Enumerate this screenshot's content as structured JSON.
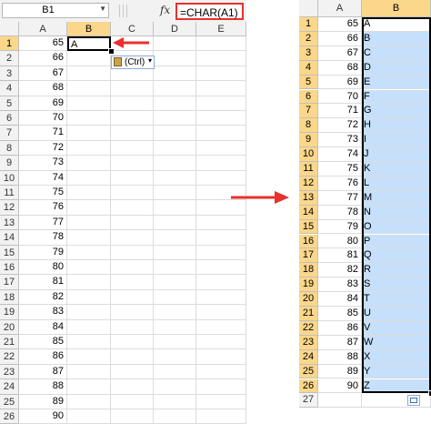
{
  "formula_bar": {
    "name_box": "B1",
    "fx_label": "fx",
    "formula": "=CHAR(A1)"
  },
  "left_sheet": {
    "columns": [
      "A",
      "B",
      "C",
      "D",
      "E"
    ],
    "rows": [
      {
        "row": "1",
        "a": "65",
        "b": "A"
      },
      {
        "row": "2",
        "a": "66",
        "b": ""
      },
      {
        "row": "3",
        "a": "67",
        "b": ""
      },
      {
        "row": "4",
        "a": "68",
        "b": ""
      },
      {
        "row": "5",
        "a": "69",
        "b": ""
      },
      {
        "row": "6",
        "a": "70",
        "b": ""
      },
      {
        "row": "7",
        "a": "71",
        "b": ""
      },
      {
        "row": "8",
        "a": "72",
        "b": ""
      },
      {
        "row": "9",
        "a": "73",
        "b": ""
      },
      {
        "row": "10",
        "a": "74",
        "b": ""
      },
      {
        "row": "11",
        "a": "75",
        "b": ""
      },
      {
        "row": "12",
        "a": "76",
        "b": ""
      },
      {
        "row": "13",
        "a": "77",
        "b": ""
      },
      {
        "row": "14",
        "a": "78",
        "b": ""
      },
      {
        "row": "15",
        "a": "79",
        "b": ""
      },
      {
        "row": "16",
        "a": "80",
        "b": ""
      },
      {
        "row": "17",
        "a": "81",
        "b": ""
      },
      {
        "row": "18",
        "a": "82",
        "b": ""
      },
      {
        "row": "19",
        "a": "83",
        "b": ""
      },
      {
        "row": "20",
        "a": "84",
        "b": ""
      },
      {
        "row": "21",
        "a": "85",
        "b": ""
      },
      {
        "row": "22",
        "a": "86",
        "b": ""
      },
      {
        "row": "23",
        "a": "87",
        "b": ""
      },
      {
        "row": "24",
        "a": "88",
        "b": ""
      },
      {
        "row": "25",
        "a": "89",
        "b": ""
      },
      {
        "row": "26",
        "a": "90",
        "b": ""
      }
    ],
    "paste_options_label": "(Ctrl)"
  },
  "right_sheet": {
    "columns": [
      "A",
      "B"
    ],
    "rows": [
      {
        "row": "1",
        "a": "65",
        "b": "A"
      },
      {
        "row": "2",
        "a": "66",
        "b": "B"
      },
      {
        "row": "3",
        "a": "67",
        "b": "C"
      },
      {
        "row": "4",
        "a": "68",
        "b": "D"
      },
      {
        "row": "5",
        "a": "69",
        "b": "E"
      },
      {
        "row": "6",
        "a": "70",
        "b": "F"
      },
      {
        "row": "7",
        "a": "71",
        "b": "G"
      },
      {
        "row": "8",
        "a": "72",
        "b": "H"
      },
      {
        "row": "9",
        "a": "73",
        "b": "I"
      },
      {
        "row": "10",
        "a": "74",
        "b": "J"
      },
      {
        "row": "11",
        "a": "75",
        "b": "K"
      },
      {
        "row": "12",
        "a": "76",
        "b": "L"
      },
      {
        "row": "13",
        "a": "77",
        "b": "M"
      },
      {
        "row": "14",
        "a": "78",
        "b": "N"
      },
      {
        "row": "15",
        "a": "79",
        "b": "O"
      },
      {
        "row": "16",
        "a": "80",
        "b": "P"
      },
      {
        "row": "17",
        "a": "81",
        "b": "Q"
      },
      {
        "row": "18",
        "a": "82",
        "b": "R"
      },
      {
        "row": "19",
        "a": "83",
        "b": "S"
      },
      {
        "row": "20",
        "a": "84",
        "b": "T"
      },
      {
        "row": "21",
        "a": "85",
        "b": "U"
      },
      {
        "row": "22",
        "a": "86",
        "b": "V"
      },
      {
        "row": "23",
        "a": "87",
        "b": "W"
      },
      {
        "row": "24",
        "a": "88",
        "b": "X"
      },
      {
        "row": "25",
        "a": "89",
        "b": "Y"
      },
      {
        "row": "26",
        "a": "90",
        "b": "Z"
      },
      {
        "row": "27",
        "a": "",
        "b": ""
      }
    ]
  },
  "colors": {
    "arrow_red": "#e8302e",
    "selected_header": "#fbd78b",
    "selection_fill": "#c6e0fb"
  }
}
